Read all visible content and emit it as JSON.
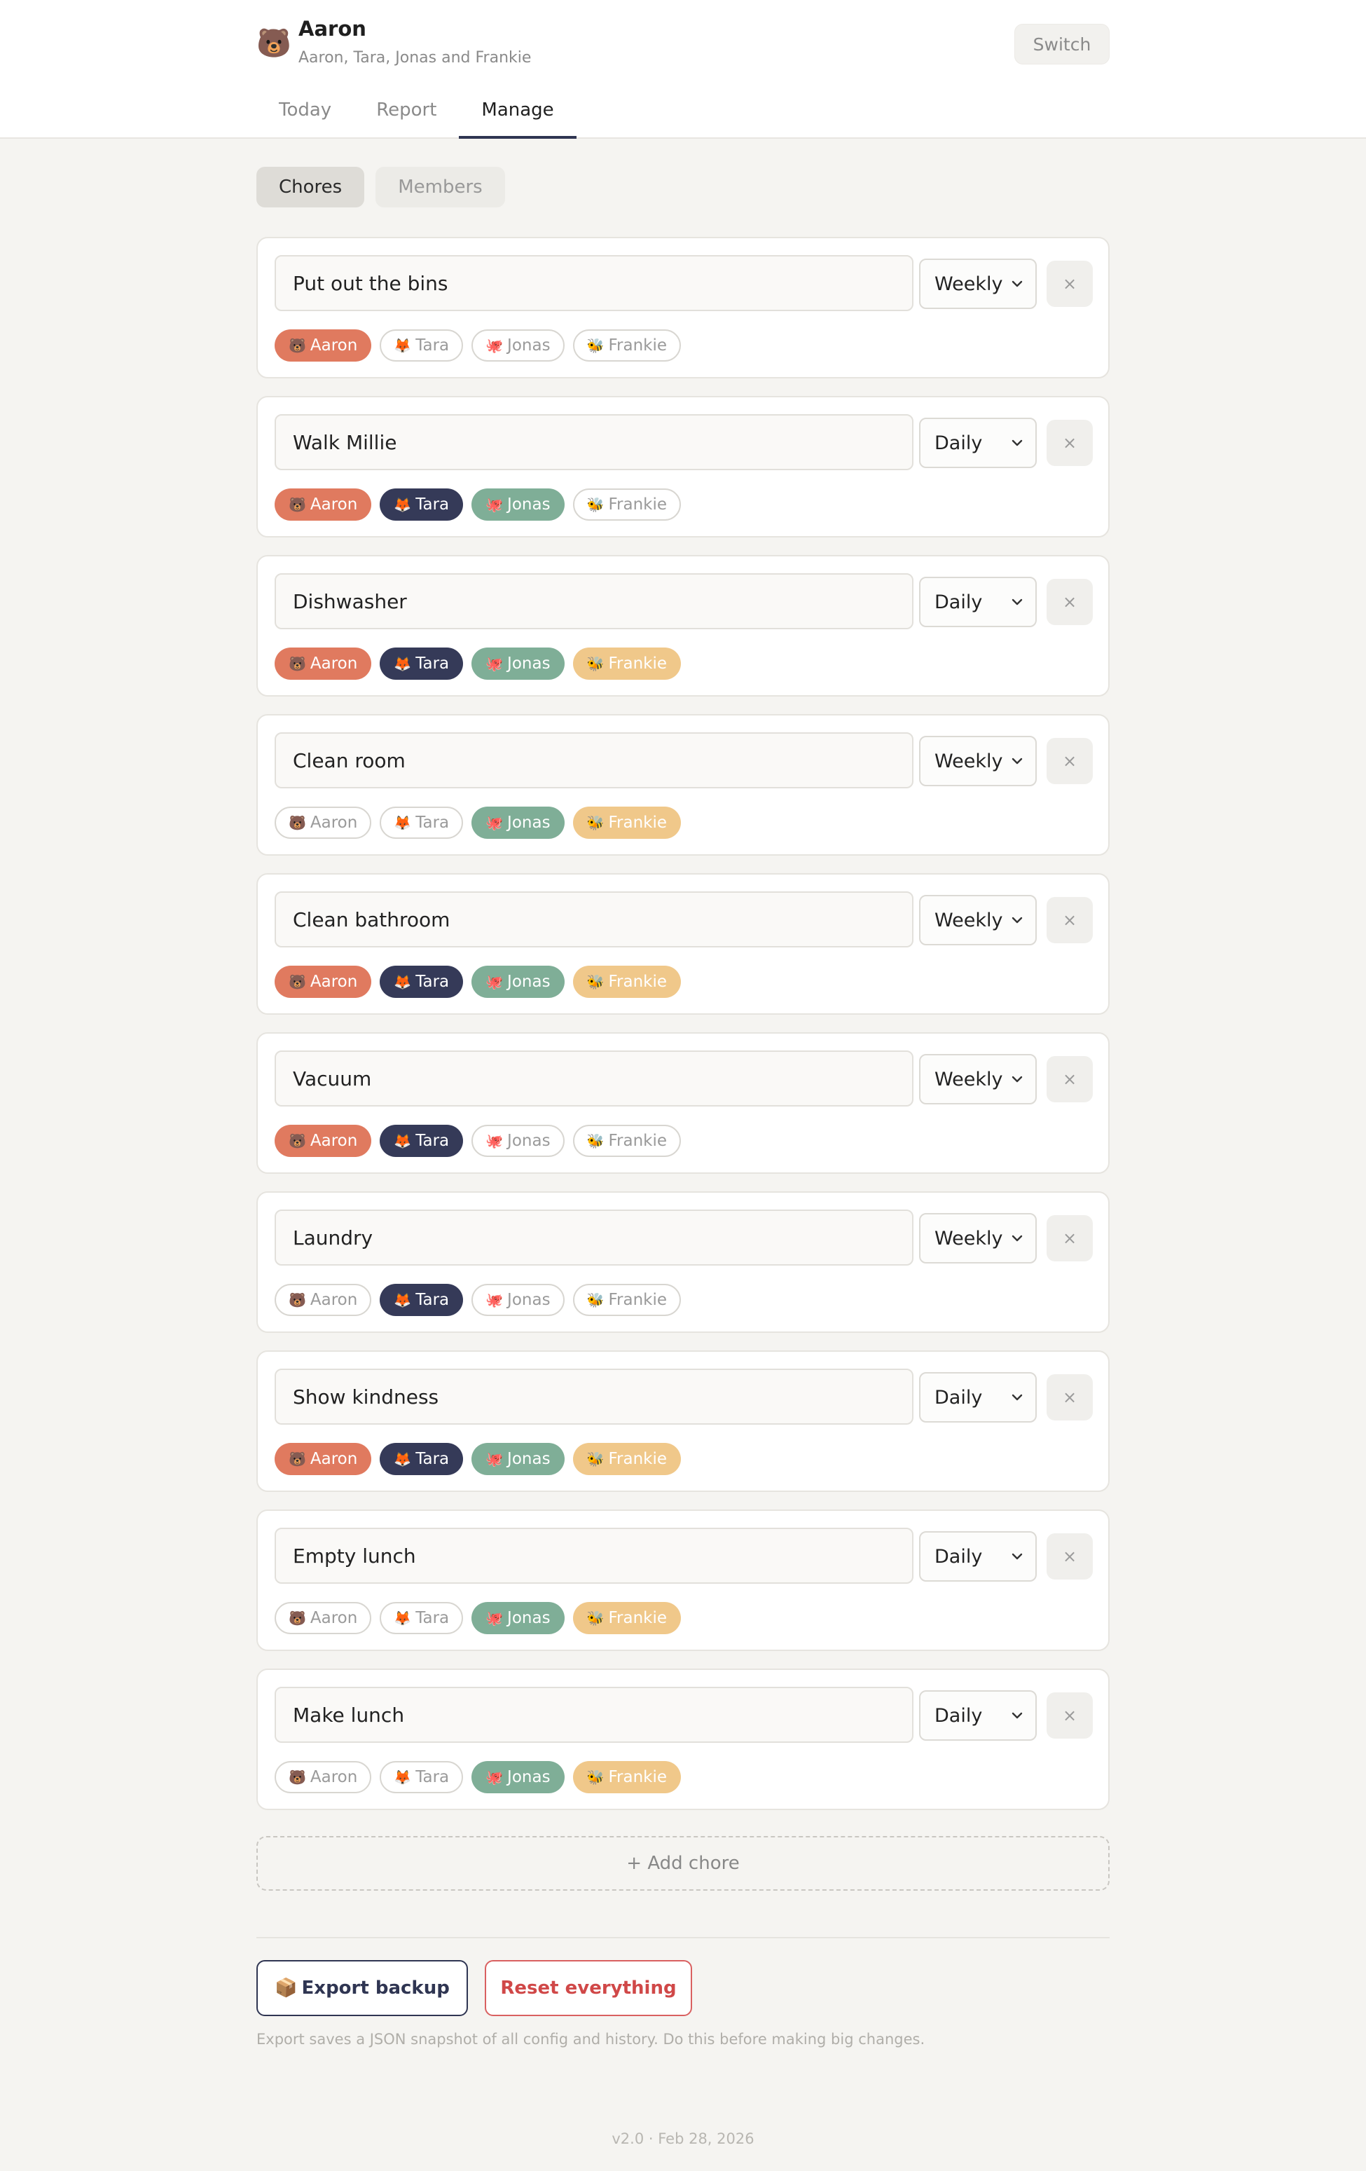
{
  "header": {
    "avatar_emoji": "🐻",
    "user_name": "Aaron",
    "household": "Aaron, Tara, Jonas and Frankie",
    "switch_label": "Switch"
  },
  "tabs": [
    {
      "label": "Today",
      "active": false
    },
    {
      "label": "Report",
      "active": false
    },
    {
      "label": "Manage",
      "active": true
    }
  ],
  "subtabs": [
    {
      "label": "Chores",
      "active": true
    },
    {
      "label": "Members",
      "active": false
    }
  ],
  "member_colors": {
    "Aaron": "#e07a5f",
    "Tara": "#353a58",
    "Jonas": "#7fae97",
    "Frankie": "#f0c88a"
  },
  "members": [
    {
      "name": "Aaron",
      "emoji": "🐻"
    },
    {
      "name": "Tara",
      "emoji": "🦊"
    },
    {
      "name": "Jonas",
      "emoji": "🐙"
    },
    {
      "name": "Frankie",
      "emoji": "🐝"
    }
  ],
  "chores": [
    {
      "name": "Put out the bins",
      "frequency": "Weekly",
      "assigned": [
        "Aaron"
      ]
    },
    {
      "name": "Walk Millie",
      "frequency": "Daily",
      "assigned": [
        "Aaron",
        "Tara",
        "Jonas"
      ]
    },
    {
      "name": "Dishwasher",
      "frequency": "Daily",
      "assigned": [
        "Aaron",
        "Tara",
        "Jonas",
        "Frankie"
      ]
    },
    {
      "name": "Clean room",
      "frequency": "Weekly",
      "assigned": [
        "Jonas",
        "Frankie"
      ]
    },
    {
      "name": "Clean bathroom",
      "frequency": "Weekly",
      "assigned": [
        "Aaron",
        "Tara",
        "Jonas",
        "Frankie"
      ]
    },
    {
      "name": "Vacuum",
      "frequency": "Weekly",
      "assigned": [
        "Aaron",
        "Tara"
      ]
    },
    {
      "name": "Laundry",
      "frequency": "Weekly",
      "assigned": [
        "Tara"
      ]
    },
    {
      "name": "Show kindness",
      "frequency": "Daily",
      "assigned": [
        "Aaron",
        "Tara",
        "Jonas",
        "Frankie"
      ]
    },
    {
      "name": "Empty lunch",
      "frequency": "Daily",
      "assigned": [
        "Jonas",
        "Frankie"
      ]
    },
    {
      "name": "Make lunch",
      "frequency": "Daily",
      "assigned": [
        "Jonas",
        "Frankie"
      ]
    }
  ],
  "remove_glyph": "×",
  "add_chore_label": "+ Add chore",
  "export": {
    "icon": "📦",
    "label": "Export backup"
  },
  "reset_label": "Reset everything",
  "export_hint": "Export saves a JSON snapshot of all config and history. Do this before making big changes.",
  "version": "v2.0 · Feb 28, 2026"
}
